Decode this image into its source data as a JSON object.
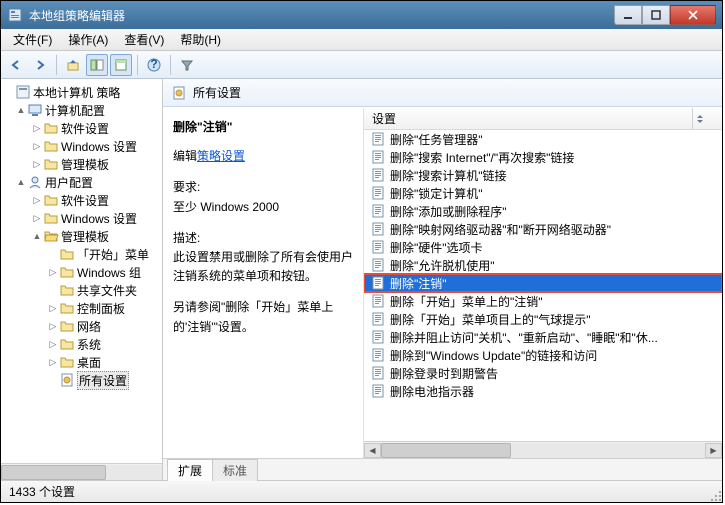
{
  "window": {
    "title": "本地组策略编辑器"
  },
  "menu": {
    "file": "文件(F)",
    "action": "操作(A)",
    "view": "查看(V)",
    "help": "帮助(H)"
  },
  "tree": {
    "root": "本地计算机 策略",
    "computer": "计算机配置",
    "user": "用户配置",
    "software": "软件设置",
    "windows": "Windows 设置",
    "admin": "管理模板",
    "start_menu": "「开始」菜单",
    "windows_group": "Windows 组",
    "shared_folders": "共享文件夹",
    "control_panel": "控制面板",
    "network": "网络",
    "system": "系统",
    "desktop": "桌面",
    "all_settings": "所有设置"
  },
  "right": {
    "header": "所有设置",
    "selected_title": "删除\"注销\"",
    "edit_prefix": "编辑",
    "edit_link": "策略设置",
    "req_label": "要求:",
    "req_value": "至少 Windows 2000",
    "desc_label": "描述:",
    "desc_value": "此设置禁用或删除了所有会使用户注销系统的菜单项和按钮。",
    "also_value": "另请参阅\"删除「开始」菜单上的'注销'\"设置。",
    "column": "设置"
  },
  "items": [
    "删除\"任务管理器\"",
    "删除\"搜索 Internet\"/\"再次搜索\"链接",
    "删除\"搜索计算机\"链接",
    "删除\"锁定计算机\"",
    "删除\"添加或删除程序\"",
    "删除\"映射网络驱动器\"和\"断开网络驱动器\"",
    "删除\"硬件\"选项卡",
    "删除\"允许脱机使用\"",
    "删除\"注销\"",
    "删除「开始」菜单上的\"注销\"",
    "删除「开始」菜单项目上的\"气球提示\"",
    "删除并阻止访问\"关机\"、\"重新启动\"、\"睡眠\"和\"休...",
    "删除到\"Windows Update\"的链接和访问",
    "删除登录时到期警告",
    "删除电池指示器"
  ],
  "selected_index": 8,
  "tabs": {
    "extended": "扩展",
    "standard": "标准"
  },
  "status": {
    "text": "1433 个设置"
  }
}
